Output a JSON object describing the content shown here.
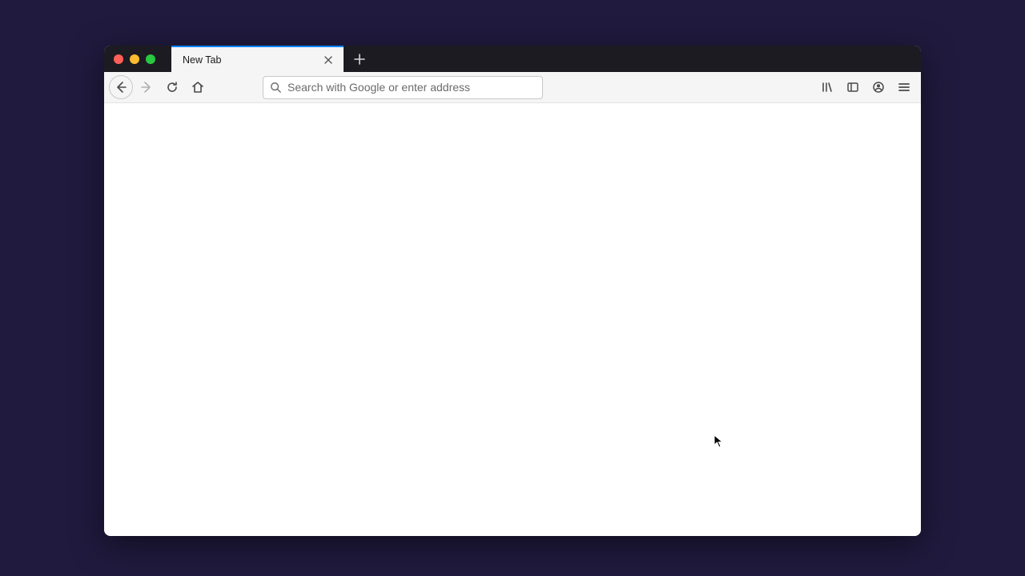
{
  "tab": {
    "title": "New Tab"
  },
  "urlbar": {
    "placeholder": "Search with Google or enter address"
  }
}
